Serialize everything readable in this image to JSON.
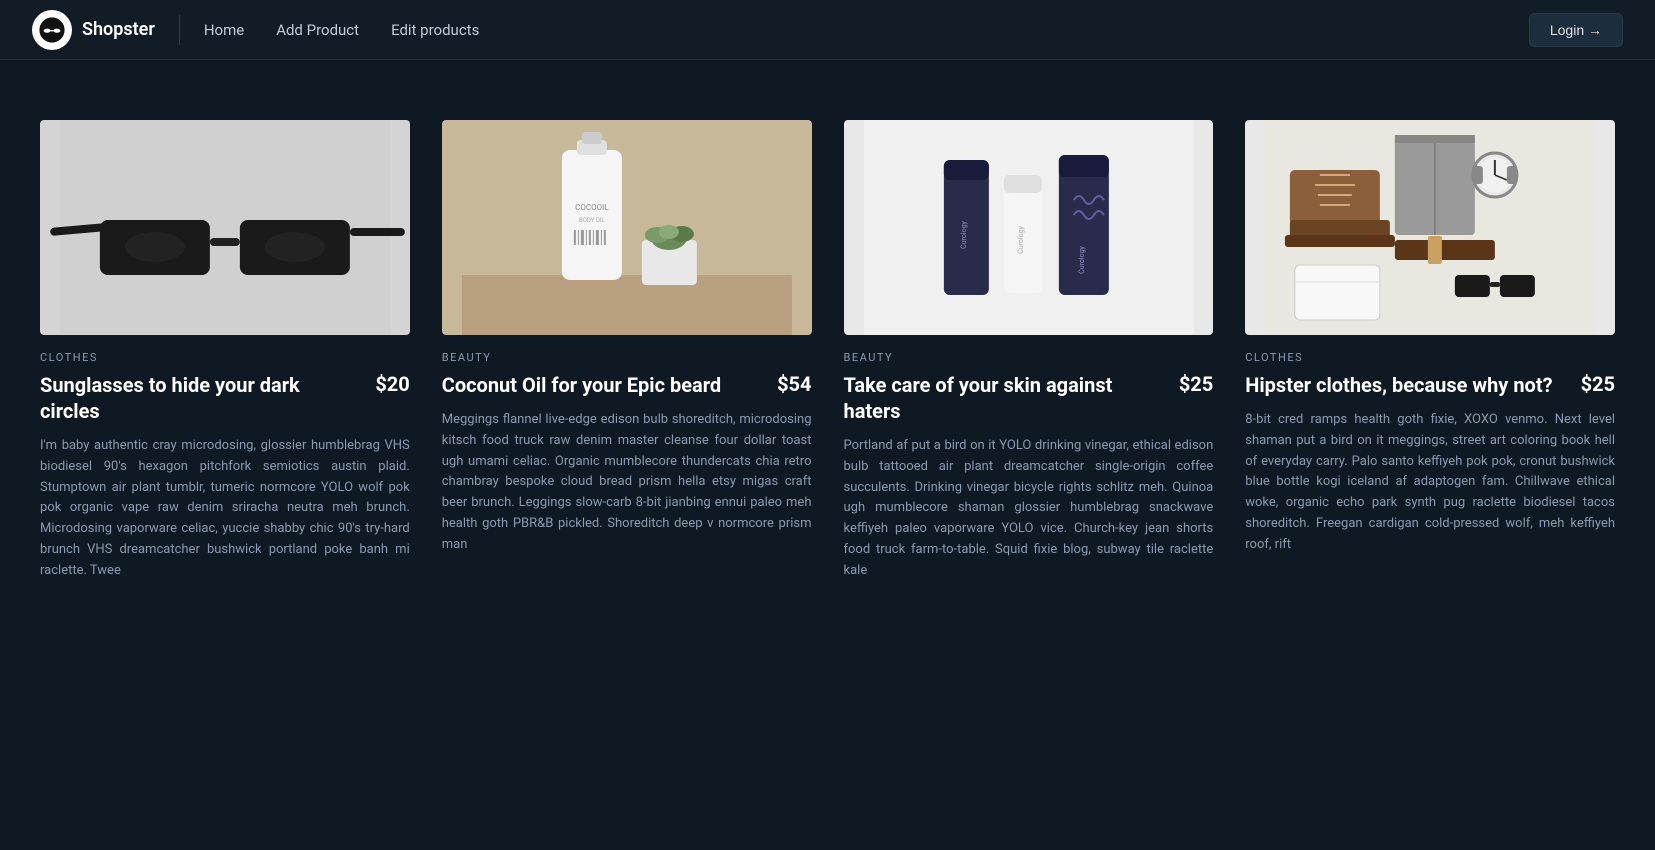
{
  "nav": {
    "logo_icon": "🥸",
    "logo_text": "Shopster",
    "links": [
      {
        "label": "Home",
        "href": "#"
      },
      {
        "label": "Add Product",
        "href": "#"
      },
      {
        "label": "Edit products",
        "href": "#"
      }
    ],
    "login_label": "Login →"
  },
  "products": [
    {
      "id": "p1",
      "category": "CLOTHES",
      "title": "Sunglasses to hide your dark circles",
      "price": "$20",
      "description": "I'm baby authentic cray microdosing, glossier humblebrag VHS biodiesel 90's hexagon pitchfork semiotics austin plaid. Stumptown air plant tumblr, tumeric normcore YOLO wolf pok pok organic vape raw denim sriracha neutra meh brunch. Microdosing vaporware celiac, yuccie shabby chic 90's try-hard brunch VHS dreamcatcher bushwick portland poke banh mi raclette. Twee",
      "image_type": "sunglasses"
    },
    {
      "id": "p2",
      "category": "BEAUTY",
      "title": "Coconut Oil for your Epic beard",
      "price": "$54",
      "description": "Meggings flannel live-edge edison bulb shoreditch, microdosing kitsch food truck raw denim master cleanse four dollar toast ugh umami celiac. Organic mumblecore thundercats chia retro chambray bespoke cloud bread prism hella etsy migas craft beer brunch. Leggings slow-carb 8-bit jianbing ennui paleo meh health goth PBR&B pickled. Shoreditch deep v normcore prism man",
      "image_type": "coconut"
    },
    {
      "id": "p3",
      "category": "BEAUTY",
      "title": "Take care of your skin against haters",
      "price": "$25",
      "description": "Portland af put a bird on it YOLO drinking vinegar, ethical edison bulb tattooed air plant dreamcatcher single-origin coffee succulents. Drinking vinegar bicycle rights schlitz meh. Quinoa ugh mumblecore shaman glossier humblebrag snackwave keffiyeh paleo vaporware YOLO vice. Church-key jean shorts food truck farm-to-table. Squid fixie blog, subway tile raclette kale",
      "image_type": "skincare"
    },
    {
      "id": "p4",
      "category": "CLOTHES",
      "title": "Hipster clothes, because why not?",
      "price": "$25",
      "description": "8-bit cred ramps health goth fixie, XOXO venmo. Next level shaman put a bird on it meggings, street art coloring book hell of everyday carry. Palo santo keffiyeh pok pok, cronut bushwick blue bottle kogi iceland af adaptogen fam. Chillwave ethical woke, organic echo park synth pug raclette biodiesel tacos shoreditch. Freegan cardigan cold-pressed wolf, meh keffiyeh roof, rift",
      "image_type": "clothes"
    }
  ]
}
